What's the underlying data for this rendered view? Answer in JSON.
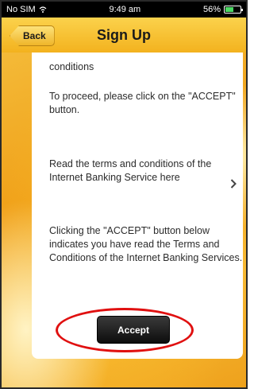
{
  "status_bar": {
    "carrier": "No SIM",
    "time": "9:49 am",
    "battery": "56%",
    "battery_level": 0.56
  },
  "nav": {
    "back_label": "Back",
    "title": "Sign Up"
  },
  "content": {
    "para1": "conditions",
    "para2": "To proceed, please click on the \"ACCEPT\" button.",
    "para3": "Read the terms and conditions of the Internet Banking Service here",
    "para4": "Clicking the \"ACCEPT\" button below indicates you have read the Terms and Conditions of the Internet Banking Services.",
    "accept_label": "Accept"
  },
  "icons": {
    "wifi": "wifi-icon",
    "battery": "battery-icon",
    "chevron": "chevron-right-icon"
  },
  "colors": {
    "nav_background": "#f3b21e",
    "highlight": "#e01010",
    "button": "#0d0d0d"
  }
}
